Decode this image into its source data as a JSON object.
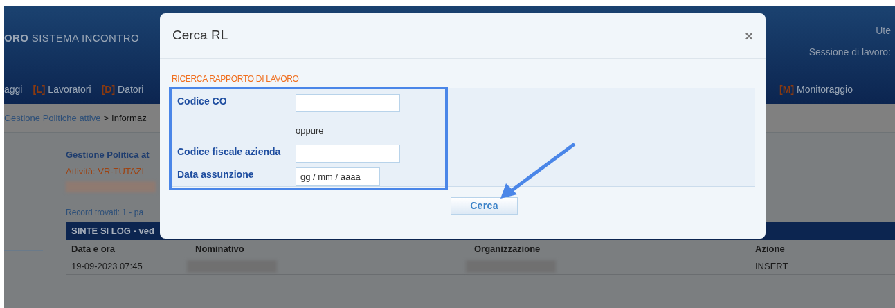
{
  "header": {
    "brand_bold": "ORO",
    "brand": "SISTEMA INCONTRO",
    "user_label": "Ute",
    "session_label": "Sessione di lavoro:"
  },
  "nav": [
    {
      "label": "aggi"
    },
    {
      "key": "[L]",
      "label": "Lavoratori"
    },
    {
      "key": "[D]",
      "label": "Datori"
    },
    {
      "key": "[M]",
      "label": "Monitoraggio"
    }
  ],
  "breadcrumb": {
    "link": "Gestione Politiche attive",
    "separator": ">",
    "current": "Informaz"
  },
  "content": {
    "title": "Gestione Politica at",
    "activity": "Attività: VR-TUTAZI",
    "records": "Record trovati: 1 - pa"
  },
  "table": {
    "title": "SINTE SI LOG - ved",
    "columns": [
      "Data e ora",
      "Nominativo",
      "Organizzazione",
      "Azione"
    ],
    "rows": [
      {
        "cells": [
          {
            "text": "19-09-2023 07:45"
          },
          {
            "redacted": true
          },
          {
            "redacted": true
          },
          {
            "text": "INSERT"
          }
        ]
      }
    ]
  },
  "dialog": {
    "title": "Cerca RL",
    "close": "×",
    "section": "RICERCA RAPPORTO DI LAVORO",
    "items": [
      {
        "kind": "field",
        "label": "Codice CO"
      },
      {
        "kind": "note",
        "text": "oppure"
      },
      {
        "kind": "field",
        "label": "Codice fiscale azienda"
      },
      {
        "kind": "date",
        "label": "Data assunzione",
        "placeholder": "gg / mm / aaaa"
      }
    ],
    "button": "Cerca"
  }
}
